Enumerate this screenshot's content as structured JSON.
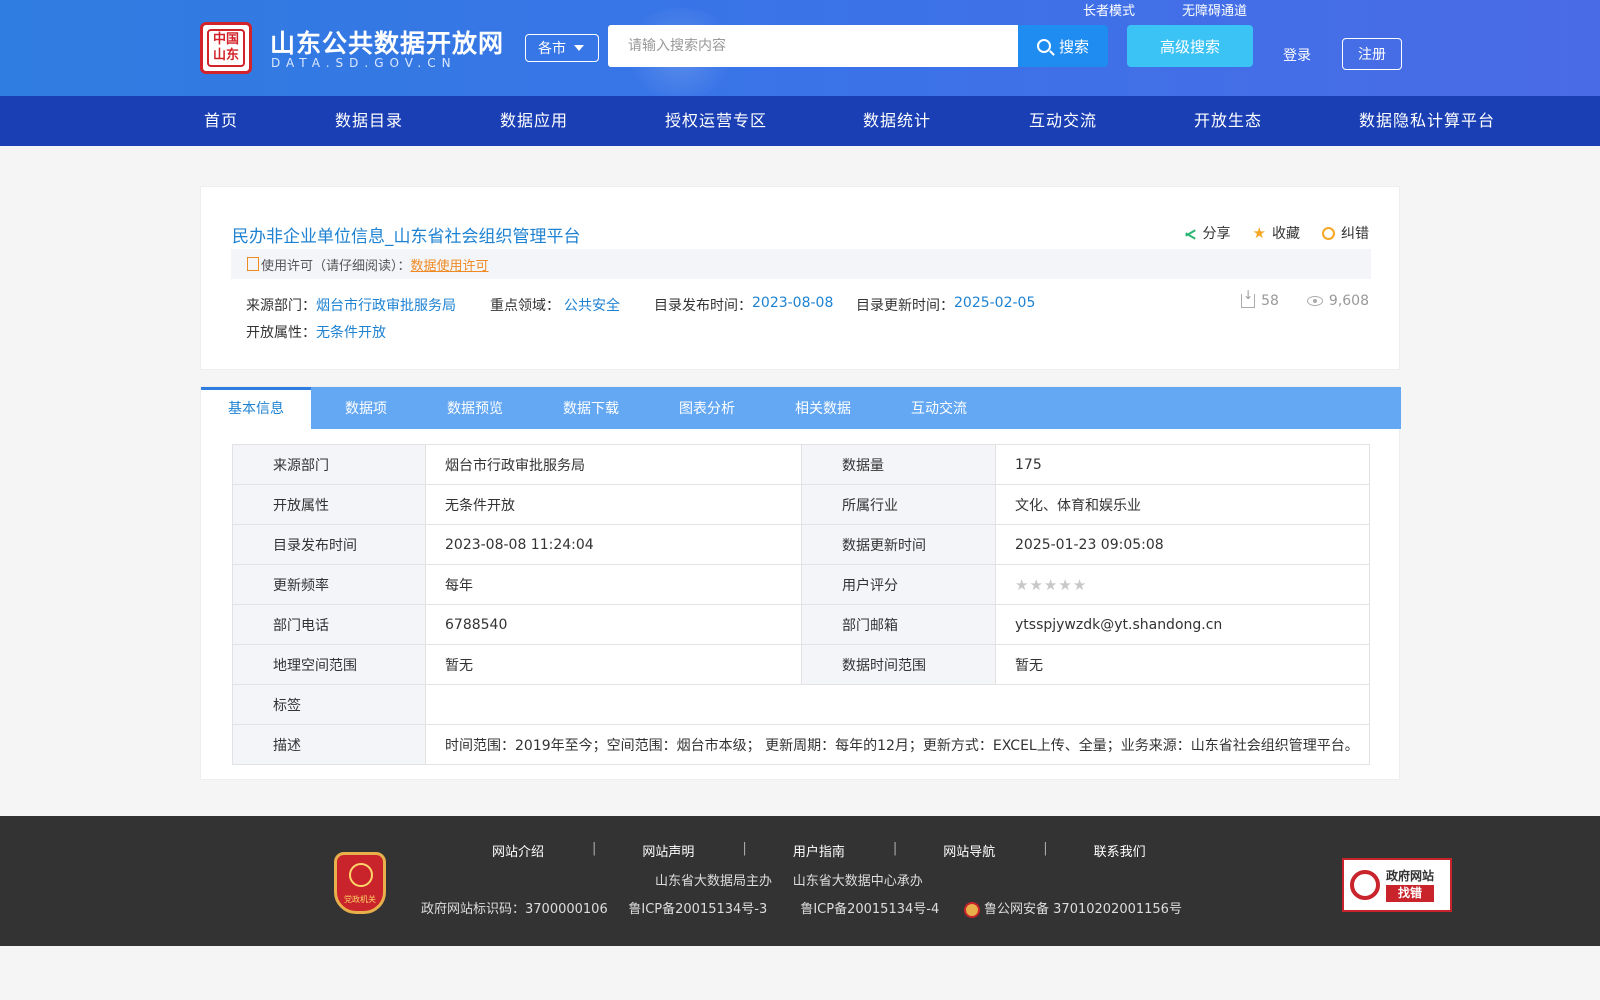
{
  "header": {
    "site_title": "山东公共数据开放网",
    "site_subtitle": "DATA.SD.GOV.CN",
    "city_select": "各市",
    "search_placeholder": "请输入搜索内容",
    "search_button": "搜索",
    "advanced_search": "高级搜索",
    "elder_mode": "长者模式",
    "accessibility": "无障碍通道",
    "login": "登录",
    "register": "注册"
  },
  "nav": {
    "items": [
      "首页",
      "数据目录",
      "数据应用",
      "授权运营专区",
      "数据统计",
      "互动交流",
      "开放生态",
      "数据隐私计算平台"
    ]
  },
  "dataset": {
    "title": "民办非企业单位信息_山东省社会组织管理平台",
    "actions": {
      "share": "分享",
      "favorite": "收藏",
      "report": "纠错"
    },
    "license_label": "使用许可（请仔细阅读）：",
    "license_link": "数据使用许可",
    "meta": {
      "source_label": "来源部门：",
      "source_value": "烟台市行政审批服务局",
      "domain_label": "重点领域：",
      "domain_value": "公共安全",
      "publish_label": "目录发布时间：",
      "publish_value": "2023-08-08",
      "update_label": "目录更新时间：",
      "update_value": "2025-02-05",
      "open_label": "开放属性：",
      "open_value": "无条件开放"
    },
    "downloads": "58",
    "views": "9,608"
  },
  "tabs": [
    "基本信息",
    "数据项",
    "数据预览",
    "数据下载",
    "图表分析",
    "相关数据",
    "互动交流"
  ],
  "info": {
    "rows": [
      {
        "k1": "来源部门",
        "v1": "烟台市行政审批服务局",
        "k2": "数据量",
        "v2": "175"
      },
      {
        "k1": "开放属性",
        "v1": "无条件开放",
        "k2": "所属行业",
        "v2": "文化、体育和娱乐业"
      },
      {
        "k1": "目录发布时间",
        "v1": "2023-08-08 11:24:04",
        "k2": "数据更新时间",
        "v2": "2025-01-23 09:05:08"
      },
      {
        "k1": "更新频率",
        "v1": "每年",
        "k2": "用户评分",
        "v2": ""
      },
      {
        "k1": "部门电话",
        "v1": "6788540",
        "k2": "部门邮箱",
        "v2": "ytsspjywzdk@yt.shandong.cn"
      },
      {
        "k1": "地理空间范围",
        "v1": "暂无",
        "k2": "数据时间范围",
        "v2": "暂无"
      }
    ],
    "tag_label": "标签",
    "tag_value": "",
    "desc_label": "描述",
    "desc_value": "时间范围：2019年至今；空间范围：烟台市本级； 更新周期：每年的12月；更新方式：EXCEL上传、全量；业务来源：山东省社会组织管理平台。",
    "rating_stars": 5,
    "rating_filled": 0
  },
  "footer": {
    "links": [
      "网站介绍",
      "网站声明",
      "用户指南",
      "网站导航",
      "联系我们"
    ],
    "host": "山东省大数据局主办",
    "organizer": "山东省大数据中心承办",
    "gov_id": "政府网站标识码：3700000106",
    "icp3": "鲁ICP备20015134号-3",
    "icp4": "鲁ICP备20015134号-4",
    "police": "鲁公网安备 37010202001156号",
    "badge_text": "党政机关",
    "error_title": "政府网站",
    "error_sub": "找错"
  }
}
